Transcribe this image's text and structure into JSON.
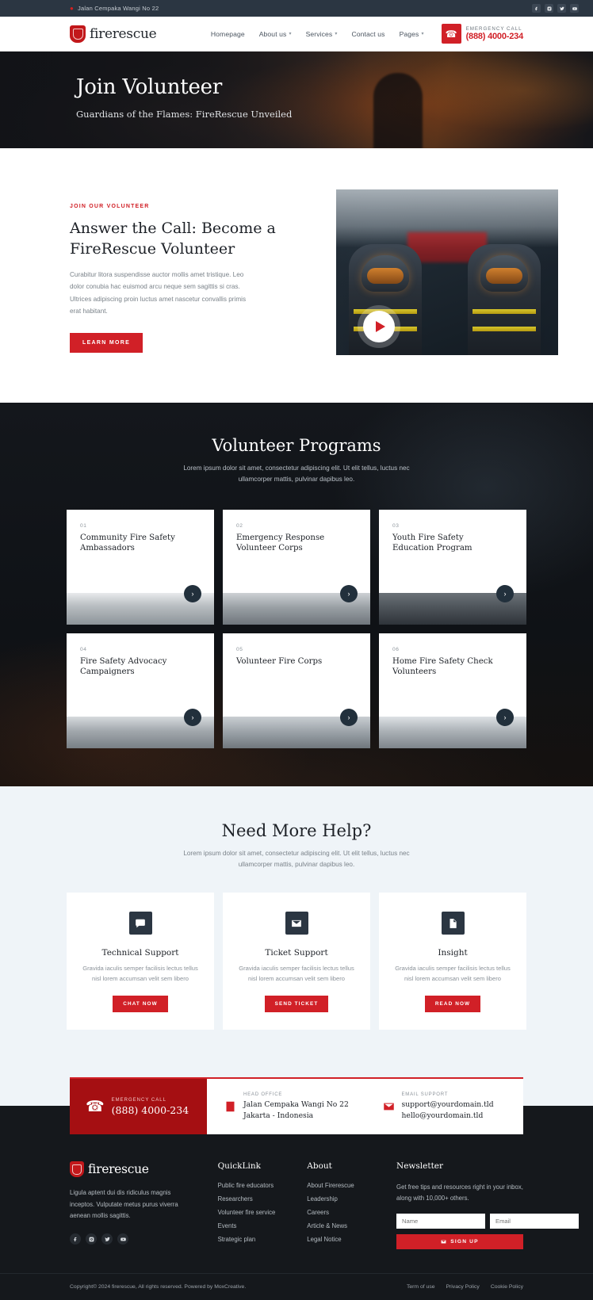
{
  "topbar": {
    "address": "Jalan Cempaka Wangi No 22",
    "pin_icon": "location-pin-icon",
    "socials": [
      "facebook",
      "instagram",
      "twitter",
      "youtube"
    ]
  },
  "nav": {
    "brand": "firerescue",
    "items": [
      {
        "label": "Homepage",
        "has_dropdown": false
      },
      {
        "label": "About us",
        "has_dropdown": true
      },
      {
        "label": "Services",
        "has_dropdown": true
      },
      {
        "label": "Contact us",
        "has_dropdown": false
      },
      {
        "label": "Pages",
        "has_dropdown": true
      }
    ],
    "emergency_label": "EMERGENCY CALL",
    "emergency_number": "(888) 4000-234",
    "emergency_icon": "phone-icon"
  },
  "hero": {
    "title": "Join Volunteer",
    "subtitle": "Guardians of the Flames: FireRescue Unveiled"
  },
  "about": {
    "eyebrow": "JOIN OUR VOLUNTEER",
    "heading": "Answer the Call: Become a FireRescue Volunteer",
    "paragraph": "Curabitur litora suspendisse auctor mollis amet tristique. Leo dolor conubia hac euismod arcu neque sem sagittis si cras. Ultrices adipiscing proin luctus amet nascetur convallis primis erat habitant.",
    "button": "LEARN MORE",
    "play_icon": "play-icon"
  },
  "programs": {
    "title": "Volunteer Programs",
    "subtitle": "Lorem ipsum dolor sit amet, consectetur adipiscing elit. Ut elit tellus, luctus nec ullamcorper mattis, pulvinar dapibus leo.",
    "cards": [
      {
        "num": "01",
        "title": "Community Fire Safety Ambassadors"
      },
      {
        "num": "02",
        "title": "Emergency Response Volunteer Corps"
      },
      {
        "num": "03",
        "title": "Youth Fire Safety Education Program"
      },
      {
        "num": "04",
        "title": "Fire Safety Advocacy Campaigners"
      },
      {
        "num": "05",
        "title": "Volunteer Fire Corps"
      },
      {
        "num": "06",
        "title": "Home Fire Safety Check Volunteers"
      }
    ],
    "arrow_icon": "chevron-right-icon"
  },
  "help": {
    "title": "Need More Help?",
    "subtitle": "Lorem ipsum dolor sit amet, consectetur adipiscing elit. Ut elit tellus, luctus nec ullamcorper mattis, pulvinar dapibus leo.",
    "cards": [
      {
        "icon": "chat-bubble-icon",
        "title": "Technical Support",
        "text": "Gravida iaculis semper facilisis lectus tellus nisl lorem accumsan velit sem libero",
        "button": "CHAT NOW"
      },
      {
        "icon": "envelope-icon",
        "title": "Ticket Support",
        "text": "Gravida iaculis semper facilisis lectus tellus nisl lorem accumsan velit sem libero",
        "button": "SEND TICKET"
      },
      {
        "icon": "document-icon",
        "title": "Insight",
        "text": "Gravida iaculis semper facilisis lectus tellus nisl lorem accumsan velit sem libero",
        "button": "READ NOW"
      }
    ]
  },
  "contact": {
    "emergency_label": "EMERGENCY CALL",
    "emergency_number": "(888) 4000-234",
    "emergency_icon": "phone-icon",
    "office_label": "HEAD OFFICE",
    "office_line1": "Jalan Cempaka Wangi No 22",
    "office_line2": "Jakarta - Indonesia",
    "office_icon": "building-icon",
    "email_label": "EMAIL SUPPORT",
    "email_line1": "support@yourdomain.tld",
    "email_line2": "hello@yourdomain.tld",
    "email_icon": "envelope-icon"
  },
  "footer": {
    "brand": "firerescue",
    "description": "Ligula aptent dui dis ridiculus magnis inceptos. Vulputate metus purus viverra aenean mollis sagittis.",
    "socials": [
      "facebook",
      "instagram",
      "twitter",
      "youtube"
    ],
    "quicklink": {
      "heading": "QuickLink",
      "items": [
        "Public fire educators",
        "Researchers",
        "Volunteer fire service",
        "Events",
        "Strategic plan"
      ]
    },
    "about": {
      "heading": "About",
      "items": [
        "About Firerescue",
        "Leadership",
        "Careers",
        "Article & News",
        "Legal Notice"
      ]
    },
    "newsletter": {
      "heading": "Newsletter",
      "text": "Get free tips and resources right in your inbox, along with 10,000+ others.",
      "name_placeholder": "Name",
      "email_placeholder": "Email",
      "button": "SIGN UP",
      "button_icon": "envelope-icon"
    },
    "copyright": "Copyright© 2024 firerescue, All rights reserved. Powered by MoxCreative.",
    "policies": [
      "Term of use",
      "Privacy Policy",
      "Cookie Policy"
    ]
  }
}
